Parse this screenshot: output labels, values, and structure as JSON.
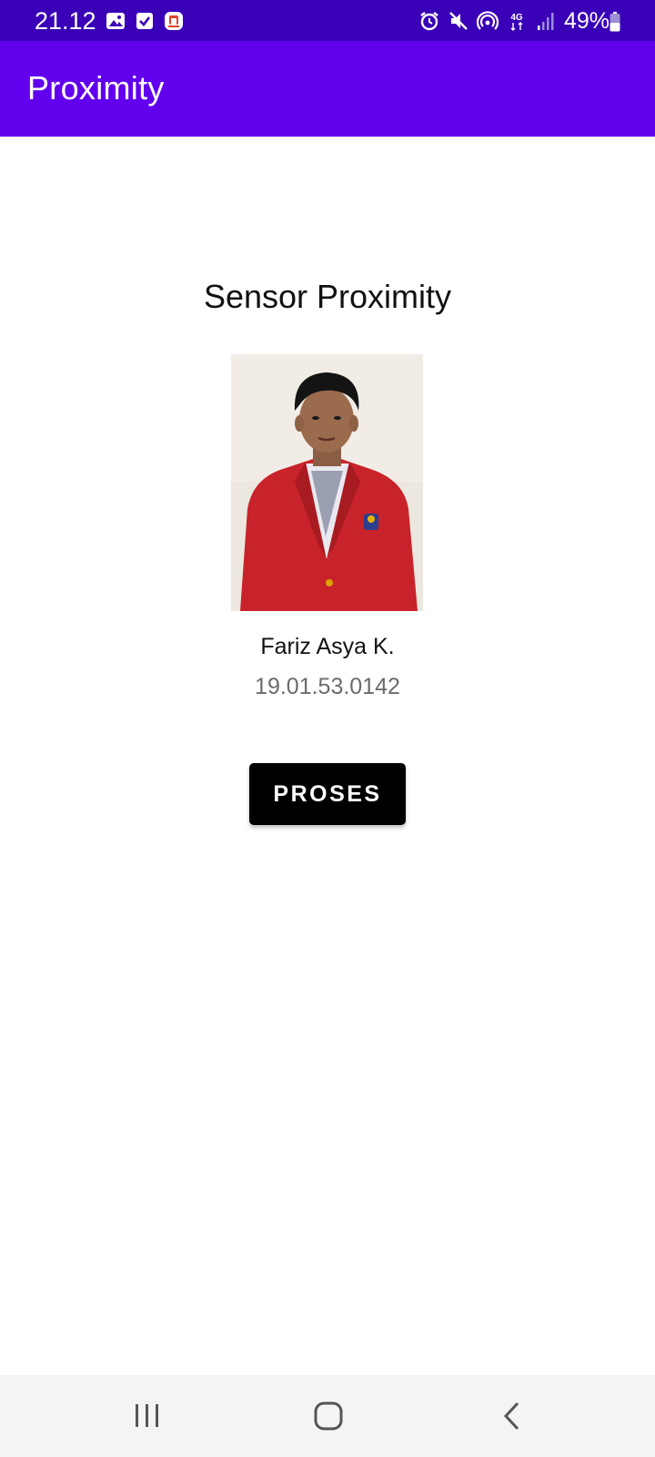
{
  "status_bar": {
    "time": "21.12",
    "battery_percent": "49%",
    "network": "4G",
    "left_icons": [
      "gallery-icon",
      "checkbox-icon",
      "app-notification-icon"
    ],
    "right_icons": [
      "alarm-icon",
      "mute-icon",
      "hotspot-icon",
      "4g-data-icon",
      "signal-icon",
      "battery-icon"
    ]
  },
  "app_bar": {
    "title": "Proximity"
  },
  "main": {
    "heading": "Sensor Proximity",
    "photo_icon": "profile-photo",
    "name": "Fariz Asya K.",
    "nim": "19.01.53.0142",
    "button_label": "PROSES"
  },
  "nav_bar": {
    "items": [
      "recent-apps-icon",
      "home-icon",
      "back-icon"
    ]
  },
  "colors": {
    "status_bar": "#3a00b8",
    "app_bar": "#6200ee",
    "button": "#000000",
    "nim_text": "#6b6b6b",
    "nav_bar": "#f4f4f4"
  }
}
